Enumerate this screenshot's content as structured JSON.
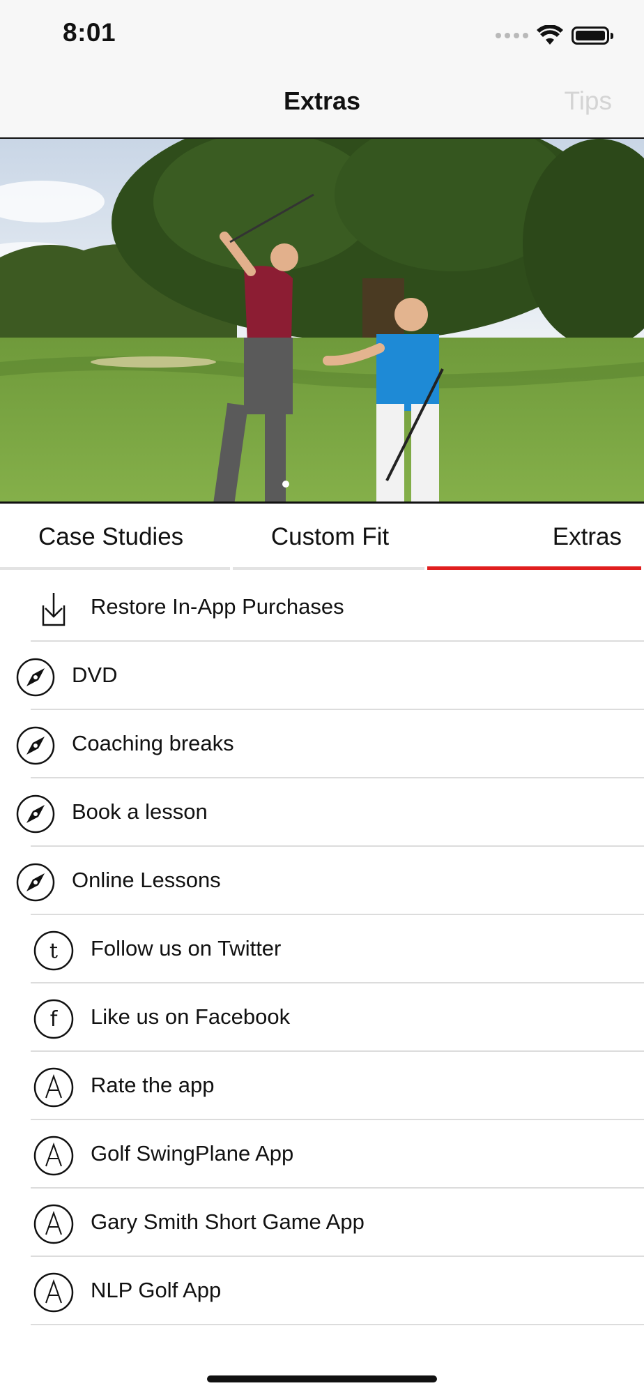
{
  "status_bar": {
    "time": "8:01"
  },
  "nav": {
    "title": "Extras",
    "right_button": "Tips"
  },
  "video": {
    "icon": "video-thumbnail-golf-lesson"
  },
  "tabs": [
    {
      "label": "Case Studies",
      "active": false
    },
    {
      "label": "Custom Fit",
      "active": false
    },
    {
      "label": "Extras",
      "active": true
    }
  ],
  "colors": {
    "accent": "#e01e1e",
    "nav_bg": "#f7f7f7",
    "separator": "#dcdcdc",
    "disabled_text": "#d4d4d4"
  },
  "list": [
    {
      "label": "Restore In-App Purchases",
      "icon": "download-icon"
    },
    {
      "label": "DVD",
      "icon": "compass-icon"
    },
    {
      "label": "Coaching breaks",
      "icon": "compass-icon"
    },
    {
      "label": "Book a lesson",
      "icon": "compass-icon"
    },
    {
      "label": "Online Lessons",
      "icon": "compass-icon"
    },
    {
      "label": "Follow us on Twitter",
      "icon": "twitter-icon"
    },
    {
      "label": "Like us on Facebook",
      "icon": "facebook-icon"
    },
    {
      "label": "Rate the app",
      "icon": "app-store-icon"
    },
    {
      "label": "Golf SwingPlane App",
      "icon": "app-store-icon"
    },
    {
      "label": "Gary Smith Short Game App",
      "icon": "app-store-icon"
    },
    {
      "label": "NLP Golf App",
      "icon": "app-store-icon"
    },
    {
      "label": "",
      "icon": "app-store-icon"
    }
  ]
}
